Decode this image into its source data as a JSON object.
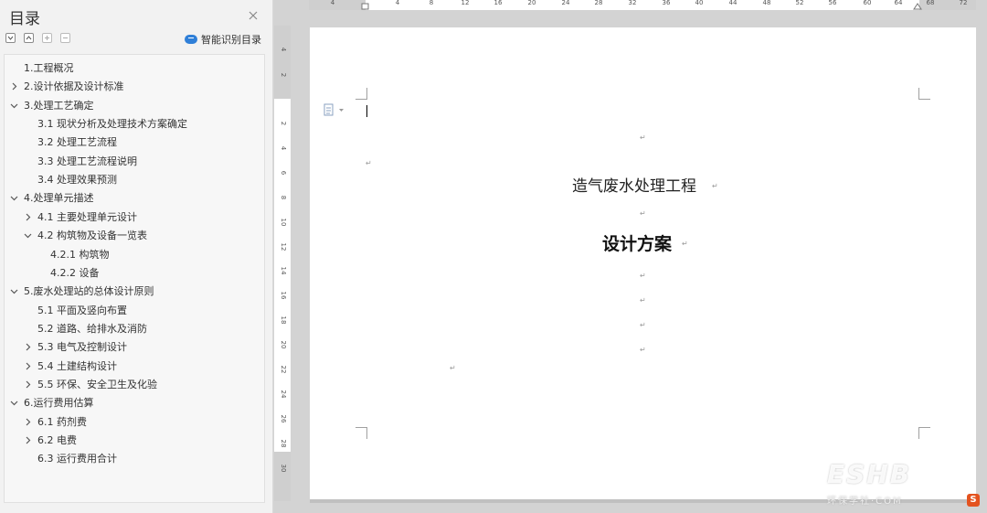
{
  "toc": {
    "title": "目录",
    "smart_button_label": "智能识别目录",
    "items": [
      {
        "label": "1.工程概况",
        "level": 1,
        "chevron": "none"
      },
      {
        "label": "2.设计依据及设计标准",
        "level": 1,
        "chevron": "right"
      },
      {
        "label": "3.处理工艺确定",
        "level": 1,
        "chevron": "down"
      },
      {
        "label": "3.1  现状分析及处理技术方案确定",
        "level": 2,
        "chevron": "none"
      },
      {
        "label": "3.2  处理工艺流程",
        "level": 2,
        "chevron": "none"
      },
      {
        "label": "3.3 处理工艺流程说明",
        "level": 2,
        "chevron": "none"
      },
      {
        "label": "3.4 处理效果预测",
        "level": 2,
        "chevron": "none"
      },
      {
        "label": "4.处理单元描述",
        "level": 1,
        "chevron": "down"
      },
      {
        "label": "4.1 主要处理单元设计",
        "level": 2,
        "chevron": "right"
      },
      {
        "label": "4.2 构筑物及设备一览表",
        "level": 2,
        "chevron": "down"
      },
      {
        "label": "4.2.1 构筑物",
        "level": 3,
        "chevron": "none"
      },
      {
        "label": "4.2.2 设备",
        "level": 3,
        "chevron": "none"
      },
      {
        "label": "5.废水处理站的总体设计原则",
        "level": 1,
        "chevron": "down"
      },
      {
        "label": "5.1 平面及竖向布置",
        "level": 2,
        "chevron": "none"
      },
      {
        "label": "5.2 道路、给排水及消防",
        "level": 2,
        "chevron": "none"
      },
      {
        "label": "5.3 电气及控制设计",
        "level": 2,
        "chevron": "right"
      },
      {
        "label": "5.4  土建结构设计",
        "level": 2,
        "chevron": "right"
      },
      {
        "label": "5.5 环保、安全卫生及化验",
        "level": 2,
        "chevron": "right"
      },
      {
        "label": "6.运行费用估算",
        "level": 1,
        "chevron": "down"
      },
      {
        "label": "6.1 药剂费",
        "level": 2,
        "chevron": "right"
      },
      {
        "label": "6.2 电费",
        "level": 2,
        "chevron": "right"
      },
      {
        "label": "6.3 运行费用合计",
        "level": 2,
        "chevron": "none"
      }
    ]
  },
  "ruler": {
    "horizontal": [
      "4",
      "4",
      "8",
      "12",
      "16",
      "20",
      "24",
      "28",
      "32",
      "36",
      "40",
      "44",
      "48",
      "52",
      "56",
      "60",
      "64",
      "68",
      "72"
    ],
    "vertical": [
      "4",
      "2",
      "2",
      "4",
      "6",
      "8",
      "10",
      "12",
      "14",
      "16",
      "18",
      "20",
      "22",
      "24",
      "26",
      "28",
      "30"
    ]
  },
  "document": {
    "title": "造气废水处理工程",
    "subtitle": "设计方案"
  },
  "watermark": {
    "main": "ESHB",
    "sub": "环保学社·COM",
    "sogou": "S"
  },
  "colors": {
    "accent": "#2f7fd8",
    "panel_bg": "#f2f2f2",
    "workspace_bg": "#d3d3d3"
  }
}
